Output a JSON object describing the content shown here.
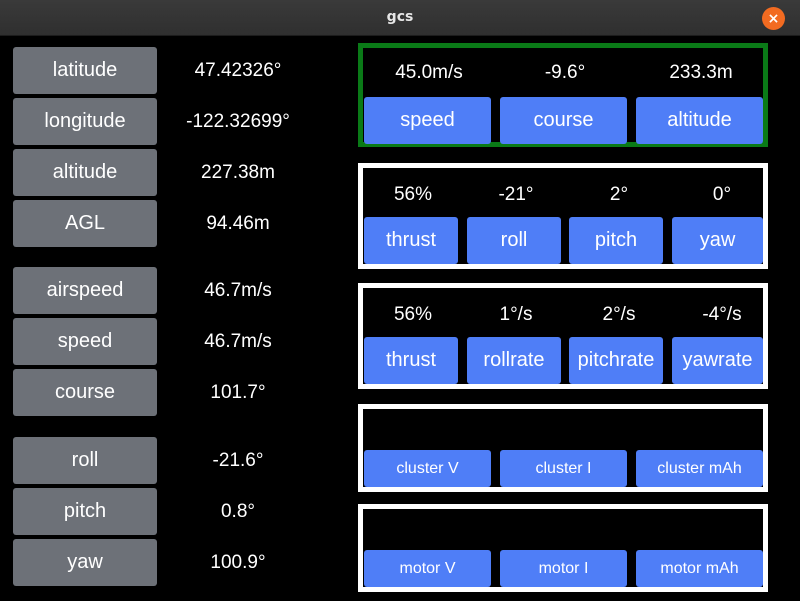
{
  "window": {
    "title": "gcs",
    "close_symbol": "×"
  },
  "telemetry": [
    {
      "label": "latitude",
      "value": "47.42326°"
    },
    {
      "label": "longitude",
      "value": "-122.32699°"
    },
    {
      "label": "altitude",
      "value": "227.38m"
    },
    {
      "label": "AGL",
      "value": "94.46m"
    },
    {
      "label": "airspeed",
      "value": "46.7m/s"
    },
    {
      "label": "speed",
      "value": "46.7m/s"
    },
    {
      "label": "course",
      "value": "101.7°"
    },
    {
      "label": "roll",
      "value": "-21.6°"
    },
    {
      "label": "pitch",
      "value": "0.8°"
    },
    {
      "label": "yaw",
      "value": "100.9°"
    }
  ],
  "panels": {
    "navigation": {
      "items": [
        {
          "label": "speed",
          "value": "45.0m/s"
        },
        {
          "label": "course",
          "value": "-9.6°"
        },
        {
          "label": "altitude",
          "value": "233.3m"
        }
      ]
    },
    "attitude": {
      "items": [
        {
          "label": "thrust",
          "value": "56%"
        },
        {
          "label": "roll",
          "value": "-21°"
        },
        {
          "label": "pitch",
          "value": "2°"
        },
        {
          "label": "yaw",
          "value": "0°"
        }
      ]
    },
    "rates": {
      "items": [
        {
          "label": "thrust",
          "value": "56%"
        },
        {
          "label": "rollrate",
          "value": "1°/s"
        },
        {
          "label": "pitchrate",
          "value": "2°/s"
        },
        {
          "label": "yawrate",
          "value": "-4°/s"
        }
      ]
    },
    "cluster": {
      "items": [
        {
          "label": "cluster V",
          "value": ""
        },
        {
          "label": "cluster I",
          "value": ""
        },
        {
          "label": "cluster mAh",
          "value": ""
        }
      ]
    },
    "motor": {
      "items": [
        {
          "label": "motor V",
          "value": ""
        },
        {
          "label": "motor I",
          "value": ""
        },
        {
          "label": "motor mAh",
          "value": ""
        }
      ]
    }
  },
  "colors": {
    "label_button": "#6d7178",
    "panel_button": "#4f7ef7",
    "active_panel_border": "#0a7a17",
    "panel_border": "#ffffff",
    "close_button": "#f26b21"
  }
}
